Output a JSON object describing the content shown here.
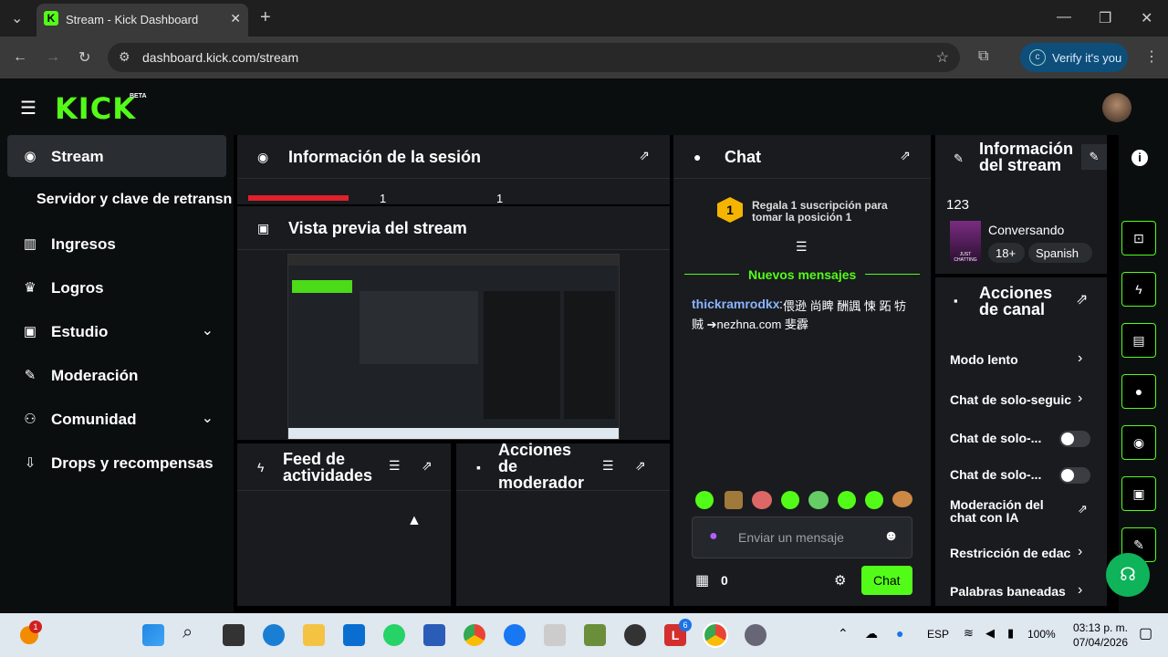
{
  "browser": {
    "tab_title": "Stream - Kick Dashboard",
    "url": "dashboard.kick.com/stream",
    "verify_label": "Verify it's you"
  },
  "header": {
    "logo": "KICK",
    "beta": "BETA"
  },
  "sidebar": {
    "items": [
      {
        "label": "Stream",
        "icon": "broadcast-icon"
      },
      {
        "label": "Servidor y clave de retransn"
      },
      {
        "label": "Ingresos",
        "icon": "chart-icon"
      },
      {
        "label": "Logros",
        "icon": "trophy-icon"
      },
      {
        "label": "Estudio",
        "icon": "studio-icon"
      },
      {
        "label": "Moderación",
        "icon": "wrench-icon"
      },
      {
        "label": "Comunidad",
        "icon": "community-icon"
      },
      {
        "label": "Drops y recompensas",
        "icon": "drops-icon"
      }
    ]
  },
  "session": {
    "title": "Información de la sesión",
    "stats": [
      "1",
      "1"
    ]
  },
  "preview": {
    "title": "Vista previa del stream"
  },
  "feed": {
    "title_l1": "Feed de",
    "title_l2": "actividades"
  },
  "mod_actions": {
    "title_l1": "Acciones",
    "title_l2": "de",
    "title_l3": "moderador"
  },
  "chat": {
    "title": "Chat",
    "gift_badge": "1",
    "gift_text_l1": "Regala 1 suscripción para",
    "gift_text_l2": "tomar la posición 1",
    "new_messages": "Nuevos mensajes",
    "message_user": "thickramrodkx",
    "message_text_l1": "偎逊 尚睥 酬諷 悚 跖 牥",
    "message_text_l2": "贼 ➔nezhna.com 斐霹",
    "input_placeholder": "Enviar un mensaje",
    "points": "0",
    "send_label": "Chat"
  },
  "stream_info": {
    "title_l1": "Información",
    "title_l2": "del stream",
    "stream_title": "123",
    "category": "Conversando",
    "badge_age": "18+",
    "badge_lang": "Spanish",
    "thumb_text": "JUST CHATTING"
  },
  "channel_actions": {
    "title_l1": "Acciones",
    "title_l2": "de canal",
    "rows": [
      {
        "label": "Modo lento",
        "control": "chevron"
      },
      {
        "label": "Chat de solo-seguic",
        "control": "chevron"
      },
      {
        "label": "Chat de solo-...",
        "control": "toggle"
      },
      {
        "label": "Chat de solo-...",
        "control": "toggle"
      },
      {
        "label_l1": "Moderación del",
        "label_l2": "chat con IA",
        "control": "popout"
      },
      {
        "label": "Restricción de edac",
        "control": "chevron"
      },
      {
        "label": "Palabras baneadas",
        "control": "chevron"
      }
    ]
  },
  "taskbar": {
    "lang": "ESP",
    "battery": "100%",
    "time": "03:13 p. m.",
    "date": "07/04/2026",
    "notif_count": "1",
    "app_badge": "6"
  },
  "colors": {
    "accent": "#53fc18",
    "panel": "#191b1f",
    "bg": "#000000"
  }
}
